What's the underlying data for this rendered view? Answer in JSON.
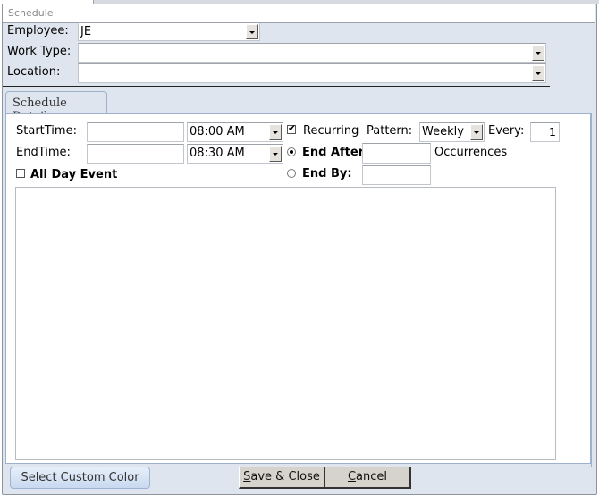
{
  "form": {
    "title": "Schedule"
  },
  "header": {
    "employee": {
      "label": "Employee:",
      "value": "JE"
    },
    "work_type": {
      "label": "Work Type:",
      "value": ""
    },
    "location": {
      "label": "Location:",
      "value": ""
    }
  },
  "tabs": [
    {
      "label": "Schedule Details",
      "active": true
    }
  ],
  "details": {
    "start_time": {
      "label": "StartTime:",
      "date_value": "",
      "time_value": "08:00 AM"
    },
    "end_time": {
      "label": "EndTime:",
      "date_value": "",
      "time_value": "08:30 AM"
    },
    "all_day": {
      "label": "All Day Event",
      "checked": false
    },
    "recurring": {
      "label": "Recurring",
      "checked": true
    },
    "pattern": {
      "label": "Pattern:",
      "value": "Weekly"
    },
    "every": {
      "label": "Every:",
      "value": "1"
    },
    "end_after": {
      "label": "End After:",
      "selected": true,
      "value": "",
      "suffix": "Occurrences"
    },
    "end_by": {
      "label": "End By:",
      "selected": false,
      "value": ""
    },
    "notes": ""
  },
  "footer": {
    "custom_color_label": "Select Custom Color",
    "save_close": {
      "prefix": "",
      "accel": "S",
      "rest": "ave & Close"
    },
    "cancel": {
      "prefix": "",
      "accel": "C",
      "rest": "ancel"
    }
  }
}
